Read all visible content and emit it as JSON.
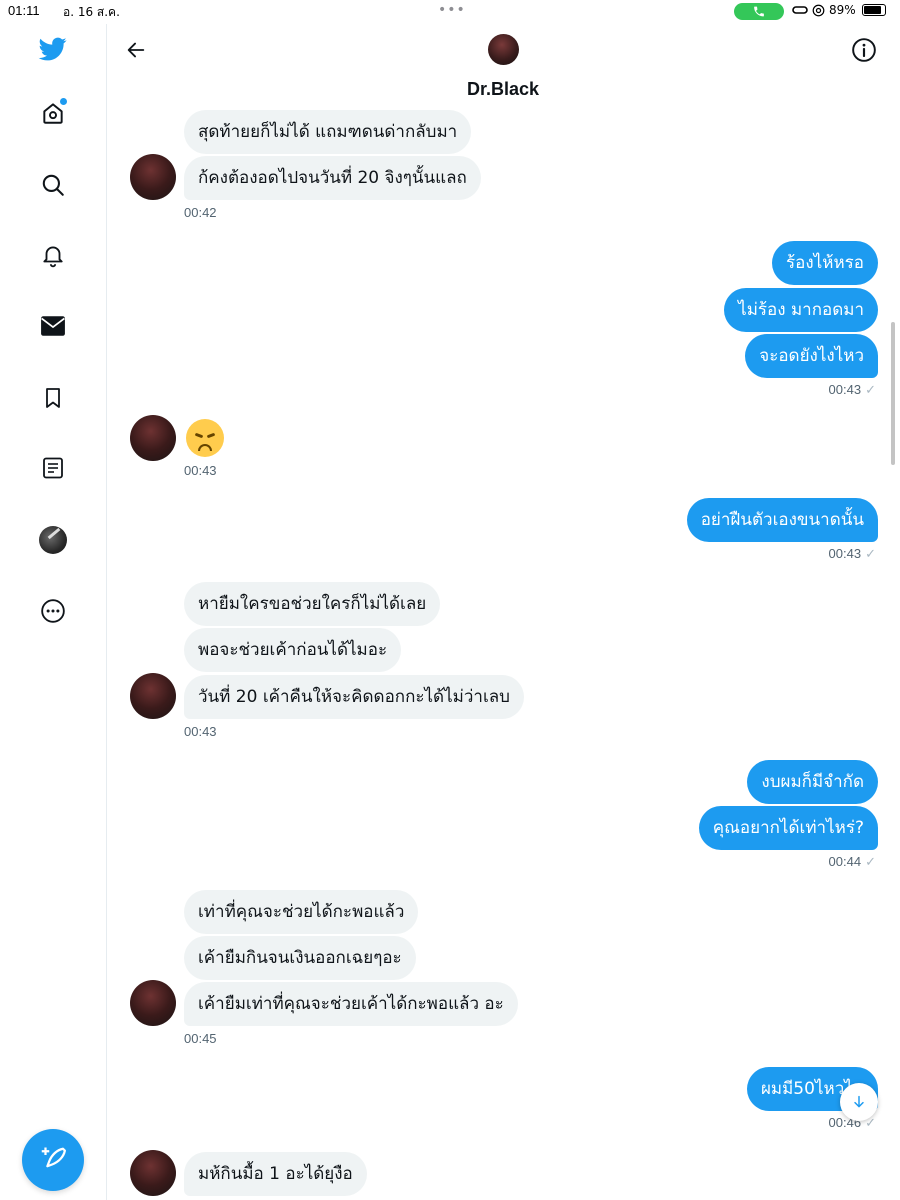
{
  "status_bar": {
    "time": "01:11",
    "date": "อ. 16 ส.ค.",
    "dots": "•••",
    "battery": "89%",
    "battery_level": 0.89
  },
  "sidebar": {
    "items": [
      {
        "icon": "home-icon",
        "has_notification": true
      },
      {
        "icon": "search-icon"
      },
      {
        "icon": "bell-icon"
      },
      {
        "icon": "mail-icon",
        "active": true
      },
      {
        "icon": "bookmark-icon"
      },
      {
        "icon": "lists-icon"
      },
      {
        "icon": "profile-icon"
      },
      {
        "icon": "more-icon"
      }
    ],
    "compose": "compose-icon"
  },
  "header": {
    "name": "Dr.Black"
  },
  "messages": {
    "m1": "สุดท้ายยก็ไม่ได้ แถมฑดนด่ากลับมา",
    "m2": "ก้คงต้องอดไปจนวันที่ 20 จิงๆนั้นแลถ",
    "t1": "00:42",
    "m3": "ร้องไห้หรอ",
    "m4": "ไม่ร้อง มากอดมา",
    "m5": "จะอดยังไงไหว",
    "t2": "00:43",
    "m6_emoji": "disappointed-face-emoji",
    "t3": "00:43",
    "m7": "อย่าฝืนตัวเองขนาดนั้น",
    "t4": "00:43",
    "m8": "หายืมใครขอช่วยใครก็ไม่ได้เลย",
    "m9": "พอจะช่วยเค้าก่อนได้ไมอะ",
    "m10": "วันที่ 20 เค้าคืนให้จะคิดดอกกะได้ไม่ว่าเลบ",
    "t5": "00:43",
    "m11": "งบผมก็มีจำกัด",
    "m12": "คุณอยากได้เท่าไหร่?",
    "t6": "00:44",
    "m13": "เท่าที่คุณจะช่วยได้กะพอแล้ว",
    "m14": "เค้ายืมกินจนเงินออกเฉยๆอะ",
    "m15": "เค้ายืมเท่าที่คุณจะช่วยเค้าได้กะพอแล้ว อะ",
    "t7": "00:45",
    "m16": "ผมมี50ไหวไห",
    "t8": "00:46",
    "m17": "มห้กินมื้อ 1 อะได้ยุงือ"
  },
  "check_mark": "✓"
}
